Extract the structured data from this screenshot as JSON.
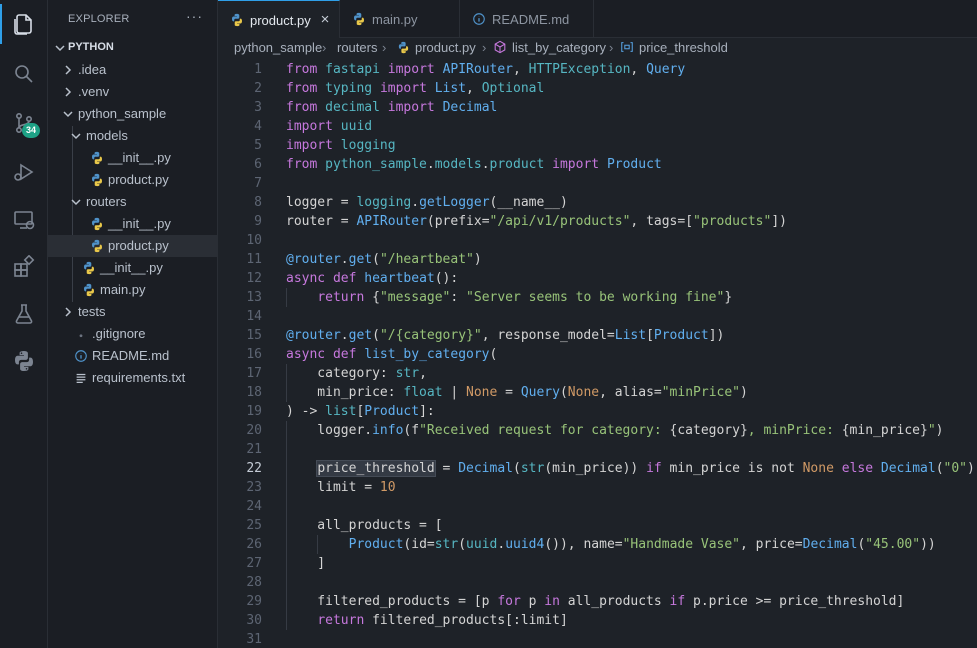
{
  "activity": {
    "items": [
      {
        "name": "explorer",
        "icon": "files-icon"
      },
      {
        "name": "search",
        "icon": "search-icon"
      },
      {
        "name": "source-control",
        "icon": "source-control-icon",
        "badge": "34"
      },
      {
        "name": "run-debug",
        "icon": "run-debug-icon"
      },
      {
        "name": "remote-explorer",
        "icon": "remote-explorer-icon"
      },
      {
        "name": "extensions",
        "icon": "extensions-icon"
      },
      {
        "name": "testing",
        "icon": "flask-icon"
      },
      {
        "name": "python",
        "icon": "python-icon"
      }
    ]
  },
  "sidebar": {
    "title": "EXPLORER",
    "more": "···",
    "root": "PYTHON",
    "tree": [
      {
        "label": ".idea",
        "kind": "folder-collapsed",
        "depth": 1
      },
      {
        "label": ".venv",
        "kind": "folder-collapsed",
        "depth": 1
      },
      {
        "label": "python_sample",
        "kind": "folder-expanded",
        "depth": 1
      },
      {
        "label": "models",
        "kind": "folder-expanded",
        "depth": 2
      },
      {
        "label": "__init__.py",
        "kind": "python",
        "depth": 3
      },
      {
        "label": "product.py",
        "kind": "python",
        "depth": 3
      },
      {
        "label": "routers",
        "kind": "folder-expanded",
        "depth": 2
      },
      {
        "label": "__init__.py",
        "kind": "python",
        "depth": 3
      },
      {
        "label": "product.py",
        "kind": "python",
        "depth": 3,
        "selected": true
      },
      {
        "label": "__init__.py",
        "kind": "python",
        "depth": 2
      },
      {
        "label": "main.py",
        "kind": "python",
        "depth": 2
      },
      {
        "label": "tests",
        "kind": "folder-collapsed",
        "depth": 1
      },
      {
        "label": ".gitignore",
        "kind": "gitignore",
        "depth": 1
      },
      {
        "label": "README.md",
        "kind": "info",
        "depth": 1
      },
      {
        "label": "requirements.txt",
        "kind": "text",
        "depth": 1
      }
    ]
  },
  "tabs": [
    {
      "label": "product.py",
      "kind": "python",
      "active": true,
      "close": "×"
    },
    {
      "label": "main.py",
      "kind": "python",
      "active": false
    },
    {
      "label": "README.md",
      "kind": "info",
      "active": false
    }
  ],
  "breadcrumb": [
    "python_sample",
    "routers",
    "product.py",
    "list_by_category",
    "price_threshold"
  ],
  "editor": {
    "current_line": 22,
    "lines": [
      [
        [
          "k",
          "from"
        ],
        [
          "v",
          " "
        ],
        [
          "mo",
          "fastapi"
        ],
        [
          "v",
          " "
        ],
        [
          "k",
          "import"
        ],
        [
          "v",
          " "
        ],
        [
          "cl",
          "APIRouter"
        ],
        [
          "v",
          ", "
        ],
        [
          "mo",
          "HTTPException"
        ],
        [
          "v",
          ", "
        ],
        [
          "cl",
          "Query"
        ]
      ],
      [
        [
          "k",
          "from"
        ],
        [
          "v",
          " "
        ],
        [
          "mo",
          "typing"
        ],
        [
          "v",
          " "
        ],
        [
          "k",
          "import"
        ],
        [
          "v",
          " "
        ],
        [
          "cl",
          "List"
        ],
        [
          "v",
          ", "
        ],
        [
          "mo",
          "Optional"
        ]
      ],
      [
        [
          "k",
          "from"
        ],
        [
          "v",
          " "
        ],
        [
          "mo",
          "decimal"
        ],
        [
          "v",
          " "
        ],
        [
          "k",
          "import"
        ],
        [
          "v",
          " "
        ],
        [
          "cl",
          "Decimal"
        ]
      ],
      [
        [
          "k",
          "import"
        ],
        [
          "v",
          " "
        ],
        [
          "mo",
          "uuid"
        ]
      ],
      [
        [
          "k",
          "import"
        ],
        [
          "v",
          " "
        ],
        [
          "mo",
          "logging"
        ]
      ],
      [
        [
          "k",
          "from"
        ],
        [
          "v",
          " "
        ],
        [
          "mo",
          "python_sample"
        ],
        [
          "v",
          "."
        ],
        [
          "mo",
          "models"
        ],
        [
          "v",
          "."
        ],
        [
          "mo",
          "product"
        ],
        [
          "v",
          " "
        ],
        [
          "k",
          "import"
        ],
        [
          "v",
          " "
        ],
        [
          "cl",
          "Product"
        ]
      ],
      [],
      [
        [
          "v",
          "logger = "
        ],
        [
          "mo",
          "logging"
        ],
        [
          "v",
          "."
        ],
        [
          "fn",
          "getLogger"
        ],
        [
          "v",
          "(__name__)"
        ]
      ],
      [
        [
          "v",
          "router = "
        ],
        [
          "cl",
          "APIRouter"
        ],
        [
          "v",
          "(prefix="
        ],
        [
          "st",
          "\"/api/v1/products\""
        ],
        [
          "v",
          ", tags=["
        ],
        [
          "st",
          "\"products\""
        ],
        [
          "v",
          "])"
        ]
      ],
      [],
      [
        [
          "fn",
          "@router"
        ],
        [
          "v",
          "."
        ],
        [
          "fn",
          "get"
        ],
        [
          "v",
          "("
        ],
        [
          "st",
          "\"/heartbeat\""
        ],
        [
          "v",
          ")"
        ]
      ],
      [
        [
          "k",
          "async"
        ],
        [
          "v",
          " "
        ],
        [
          "k",
          "def"
        ],
        [
          "v",
          " "
        ],
        [
          "fn",
          "heartbeat"
        ],
        [
          "v",
          "():"
        ]
      ],
      [
        [
          "v",
          "    "
        ],
        [
          "k",
          "return"
        ],
        [
          "v",
          " {"
        ],
        [
          "st",
          "\"message\""
        ],
        [
          "v",
          ": "
        ],
        [
          "st",
          "\"Server seems to be working fine\""
        ],
        [
          "v",
          "}"
        ]
      ],
      [],
      [
        [
          "fn",
          "@router"
        ],
        [
          "v",
          "."
        ],
        [
          "fn",
          "get"
        ],
        [
          "v",
          "("
        ],
        [
          "st",
          "\"/{category}\""
        ],
        [
          "v",
          ", response_model="
        ],
        [
          "cl",
          "List"
        ],
        [
          "v",
          "["
        ],
        [
          "cl",
          "Product"
        ],
        [
          "v",
          "])"
        ]
      ],
      [
        [
          "k",
          "async"
        ],
        [
          "v",
          " "
        ],
        [
          "k",
          "def"
        ],
        [
          "v",
          " "
        ],
        [
          "fn",
          "list_by_category"
        ],
        [
          "v",
          "("
        ]
      ],
      [
        [
          "v",
          "    category: "
        ],
        [
          "bi",
          "str"
        ],
        [
          "v",
          ","
        ]
      ],
      [
        [
          "v",
          "    min_price: "
        ],
        [
          "bi",
          "float"
        ],
        [
          "v",
          " | "
        ],
        [
          "kc",
          "None"
        ],
        [
          "v",
          " = "
        ],
        [
          "cl",
          "Query"
        ],
        [
          "v",
          "("
        ],
        [
          "kc",
          "None"
        ],
        [
          "v",
          ", alias="
        ],
        [
          "st",
          "\"minPrice\""
        ],
        [
          "v",
          ")"
        ]
      ],
      [
        [
          "v",
          ") -> "
        ],
        [
          "bi",
          "list"
        ],
        [
          "v",
          "["
        ],
        [
          "cl",
          "Product"
        ],
        [
          "v",
          "]:"
        ]
      ],
      [
        [
          "v",
          "    logger."
        ],
        [
          "fn",
          "info"
        ],
        [
          "v",
          "(f"
        ],
        [
          "st",
          "\"Received request for category: "
        ],
        [
          "v",
          "{category}"
        ],
        [
          "st",
          ", minPrice: "
        ],
        [
          "v",
          "{min_price}"
        ],
        [
          "st",
          "\""
        ],
        [
          "v",
          ")"
        ]
      ],
      [],
      [
        [
          "v",
          "    "
        ],
        [
          "hl",
          "price_threshold"
        ],
        [
          "v",
          " = "
        ],
        [
          "cl",
          "Decimal"
        ],
        [
          "v",
          "("
        ],
        [
          "bi",
          "str"
        ],
        [
          "v",
          "(min_price)) "
        ],
        [
          "k",
          "if"
        ],
        [
          "v",
          " min_price is not "
        ],
        [
          "kc",
          "None"
        ],
        [
          "v",
          " "
        ],
        [
          "k",
          "else"
        ],
        [
          "v",
          " "
        ],
        [
          "cl",
          "Decimal"
        ],
        [
          "v",
          "("
        ],
        [
          "st",
          "\"0\""
        ],
        [
          "v",
          ")"
        ]
      ],
      [
        [
          "v",
          "    limit = "
        ],
        [
          "nu",
          "10"
        ]
      ],
      [],
      [
        [
          "v",
          "    all_products = ["
        ]
      ],
      [
        [
          "v",
          "        "
        ],
        [
          "cl",
          "Product"
        ],
        [
          "v",
          "(id="
        ],
        [
          "bi",
          "str"
        ],
        [
          "v",
          "("
        ],
        [
          "mo",
          "uuid"
        ],
        [
          "v",
          "."
        ],
        [
          "fn",
          "uuid4"
        ],
        [
          "v",
          "()), name="
        ],
        [
          "st",
          "\"Handmade Vase\""
        ],
        [
          "v",
          ", price="
        ],
        [
          "cl",
          "Decimal"
        ],
        [
          "v",
          "("
        ],
        [
          "st",
          "\"45.00\""
        ],
        [
          "v",
          "))"
        ]
      ],
      [
        [
          "v",
          "    ]"
        ]
      ],
      [],
      [
        [
          "v",
          "    filtered_products = [p "
        ],
        [
          "k",
          "for"
        ],
        [
          "v",
          " p "
        ],
        [
          "k",
          "in"
        ],
        [
          "v",
          " all_products "
        ],
        [
          "k",
          "if"
        ],
        [
          "v",
          " p.price >= price_threshold]"
        ]
      ],
      [
        [
          "v",
          "    "
        ],
        [
          "k",
          "return"
        ],
        [
          "v",
          " filtered_products[:limit]"
        ]
      ],
      []
    ]
  }
}
